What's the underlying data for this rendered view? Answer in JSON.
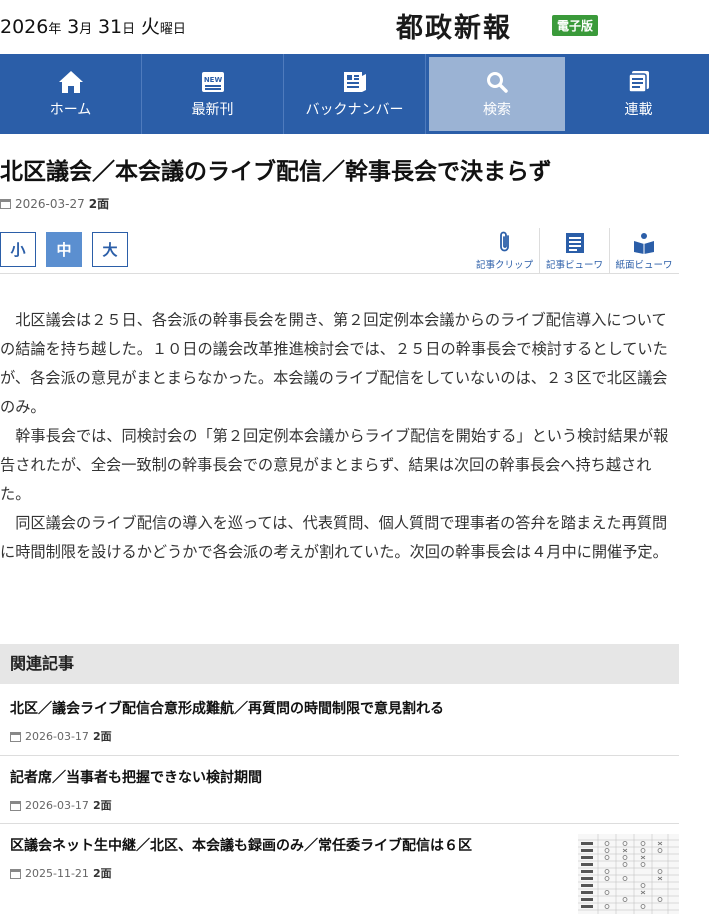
{
  "header": {
    "year": "2026",
    "year_unit": "年",
    "month": "3",
    "month_unit": "月",
    "day": "31",
    "day_unit": "日",
    "weekday": "火",
    "weekday_unit": "曜日",
    "logo": "都政新報",
    "edition": "電子版"
  },
  "nav": {
    "items": [
      {
        "label": "ホーム",
        "icon": "home-icon"
      },
      {
        "label": "最新刊",
        "icon": "new-icon"
      },
      {
        "label": "バックナンバー",
        "icon": "backnumber-icon"
      },
      {
        "label": "検索",
        "icon": "search-icon"
      },
      {
        "label": "連載",
        "icon": "series-icon"
      }
    ],
    "active": "検索",
    "colors": {
      "bar": "#2b5ea8",
      "active": "#9bb3d4"
    }
  },
  "article": {
    "title": "北区議会／本会議のライブ配信／幹事長会で決まらず",
    "date": "2026-03-27",
    "page": "2面",
    "size_buttons": [
      "小",
      "中",
      "大"
    ],
    "active_size": "中",
    "tools": [
      {
        "label": "記事クリップ",
        "icon": "clip-icon"
      },
      {
        "label": "記事ビューワ",
        "icon": "article-viewer-icon"
      },
      {
        "label": "紙面ビューワ",
        "icon": "paper-viewer-icon"
      }
    ],
    "paragraphs": [
      "北区議会は２５日、各会派の幹事長会を開き、第２回定例本会議からのライブ配信導入についての結論を持ち越した。１０日の議会改革推進検討会では、２５日の幹事長会で検討するとしていたが、各会派の意見がまとまらなかった。本会議のライブ配信をしていないのは、２３区で北区議会のみ。",
      "幹事長会では、同検討会の「第２回定例本会議からライブ配信を開始する」という検討結果が報告されたが、全会一致制の幹事長会での意見がまとまらず、結果は次回の幹事長会へ持ち越された。",
      "同区議会のライブ配信の導入を巡っては、代表質問、個人質問で理事者の答弁を踏まえた再質問に時間制限を設けるかどうかで各会派の考えが割れていた。次回の幹事長会は４月中に開催予定。"
    ]
  },
  "related": {
    "heading": "関連記事",
    "items": [
      {
        "title": "北区／議会ライブ配信合意形成難航／再質問の時間制限で意見割れる",
        "date": "2026-03-17",
        "page": "2面"
      },
      {
        "title": "記者席／当事者も把握できない検討期間",
        "date": "2026-03-17",
        "page": "2面"
      },
      {
        "title": "区議会ネット生中継／北区、本会議も録画のみ／常任委ライブ配信は６区",
        "date": "2025-11-21",
        "page": "2面"
      }
    ]
  }
}
